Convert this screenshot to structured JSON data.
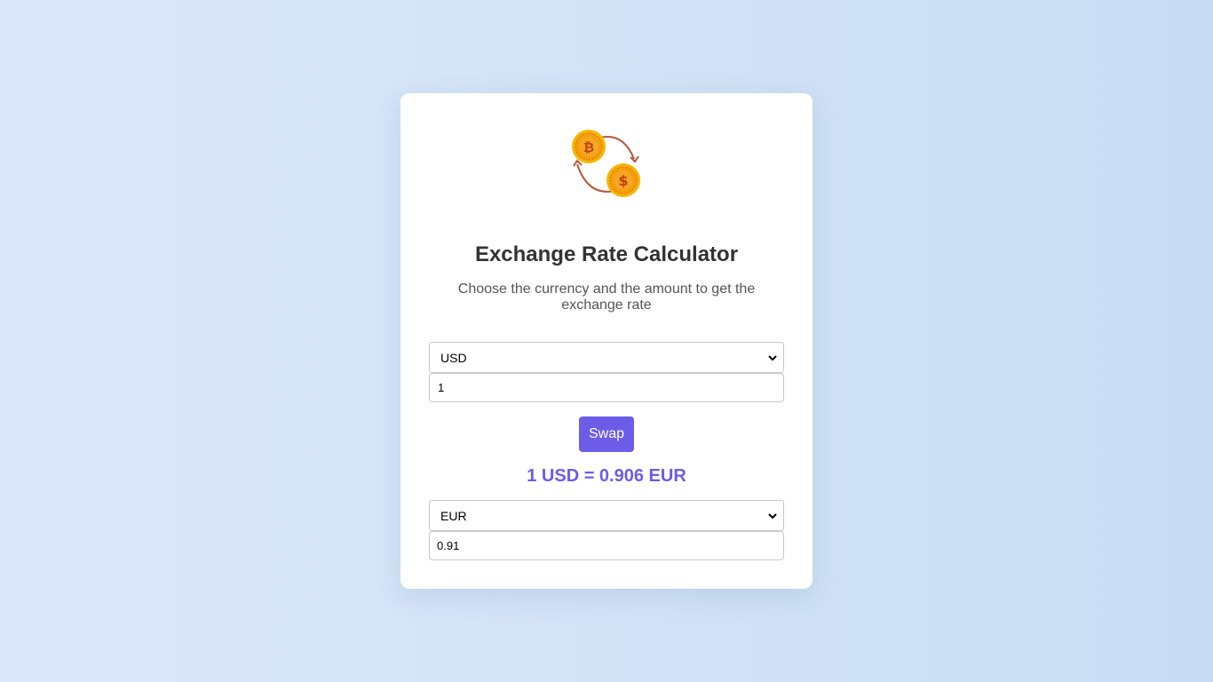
{
  "header": {
    "title": "Exchange Rate Calculator",
    "subtitle": "Choose the currency and the amount to get the exchange rate",
    "logo_icon": "currency-exchange-icon"
  },
  "from": {
    "currency": "USD",
    "amount": "1"
  },
  "swap_label": "Swap",
  "rate_text": "1 USD = 0.906 EUR",
  "to": {
    "currency": "EUR",
    "amount": "0.91"
  },
  "colors": {
    "accent": "#6c5ce7",
    "coin": "#f5a623",
    "arrow": "#b5573a"
  }
}
